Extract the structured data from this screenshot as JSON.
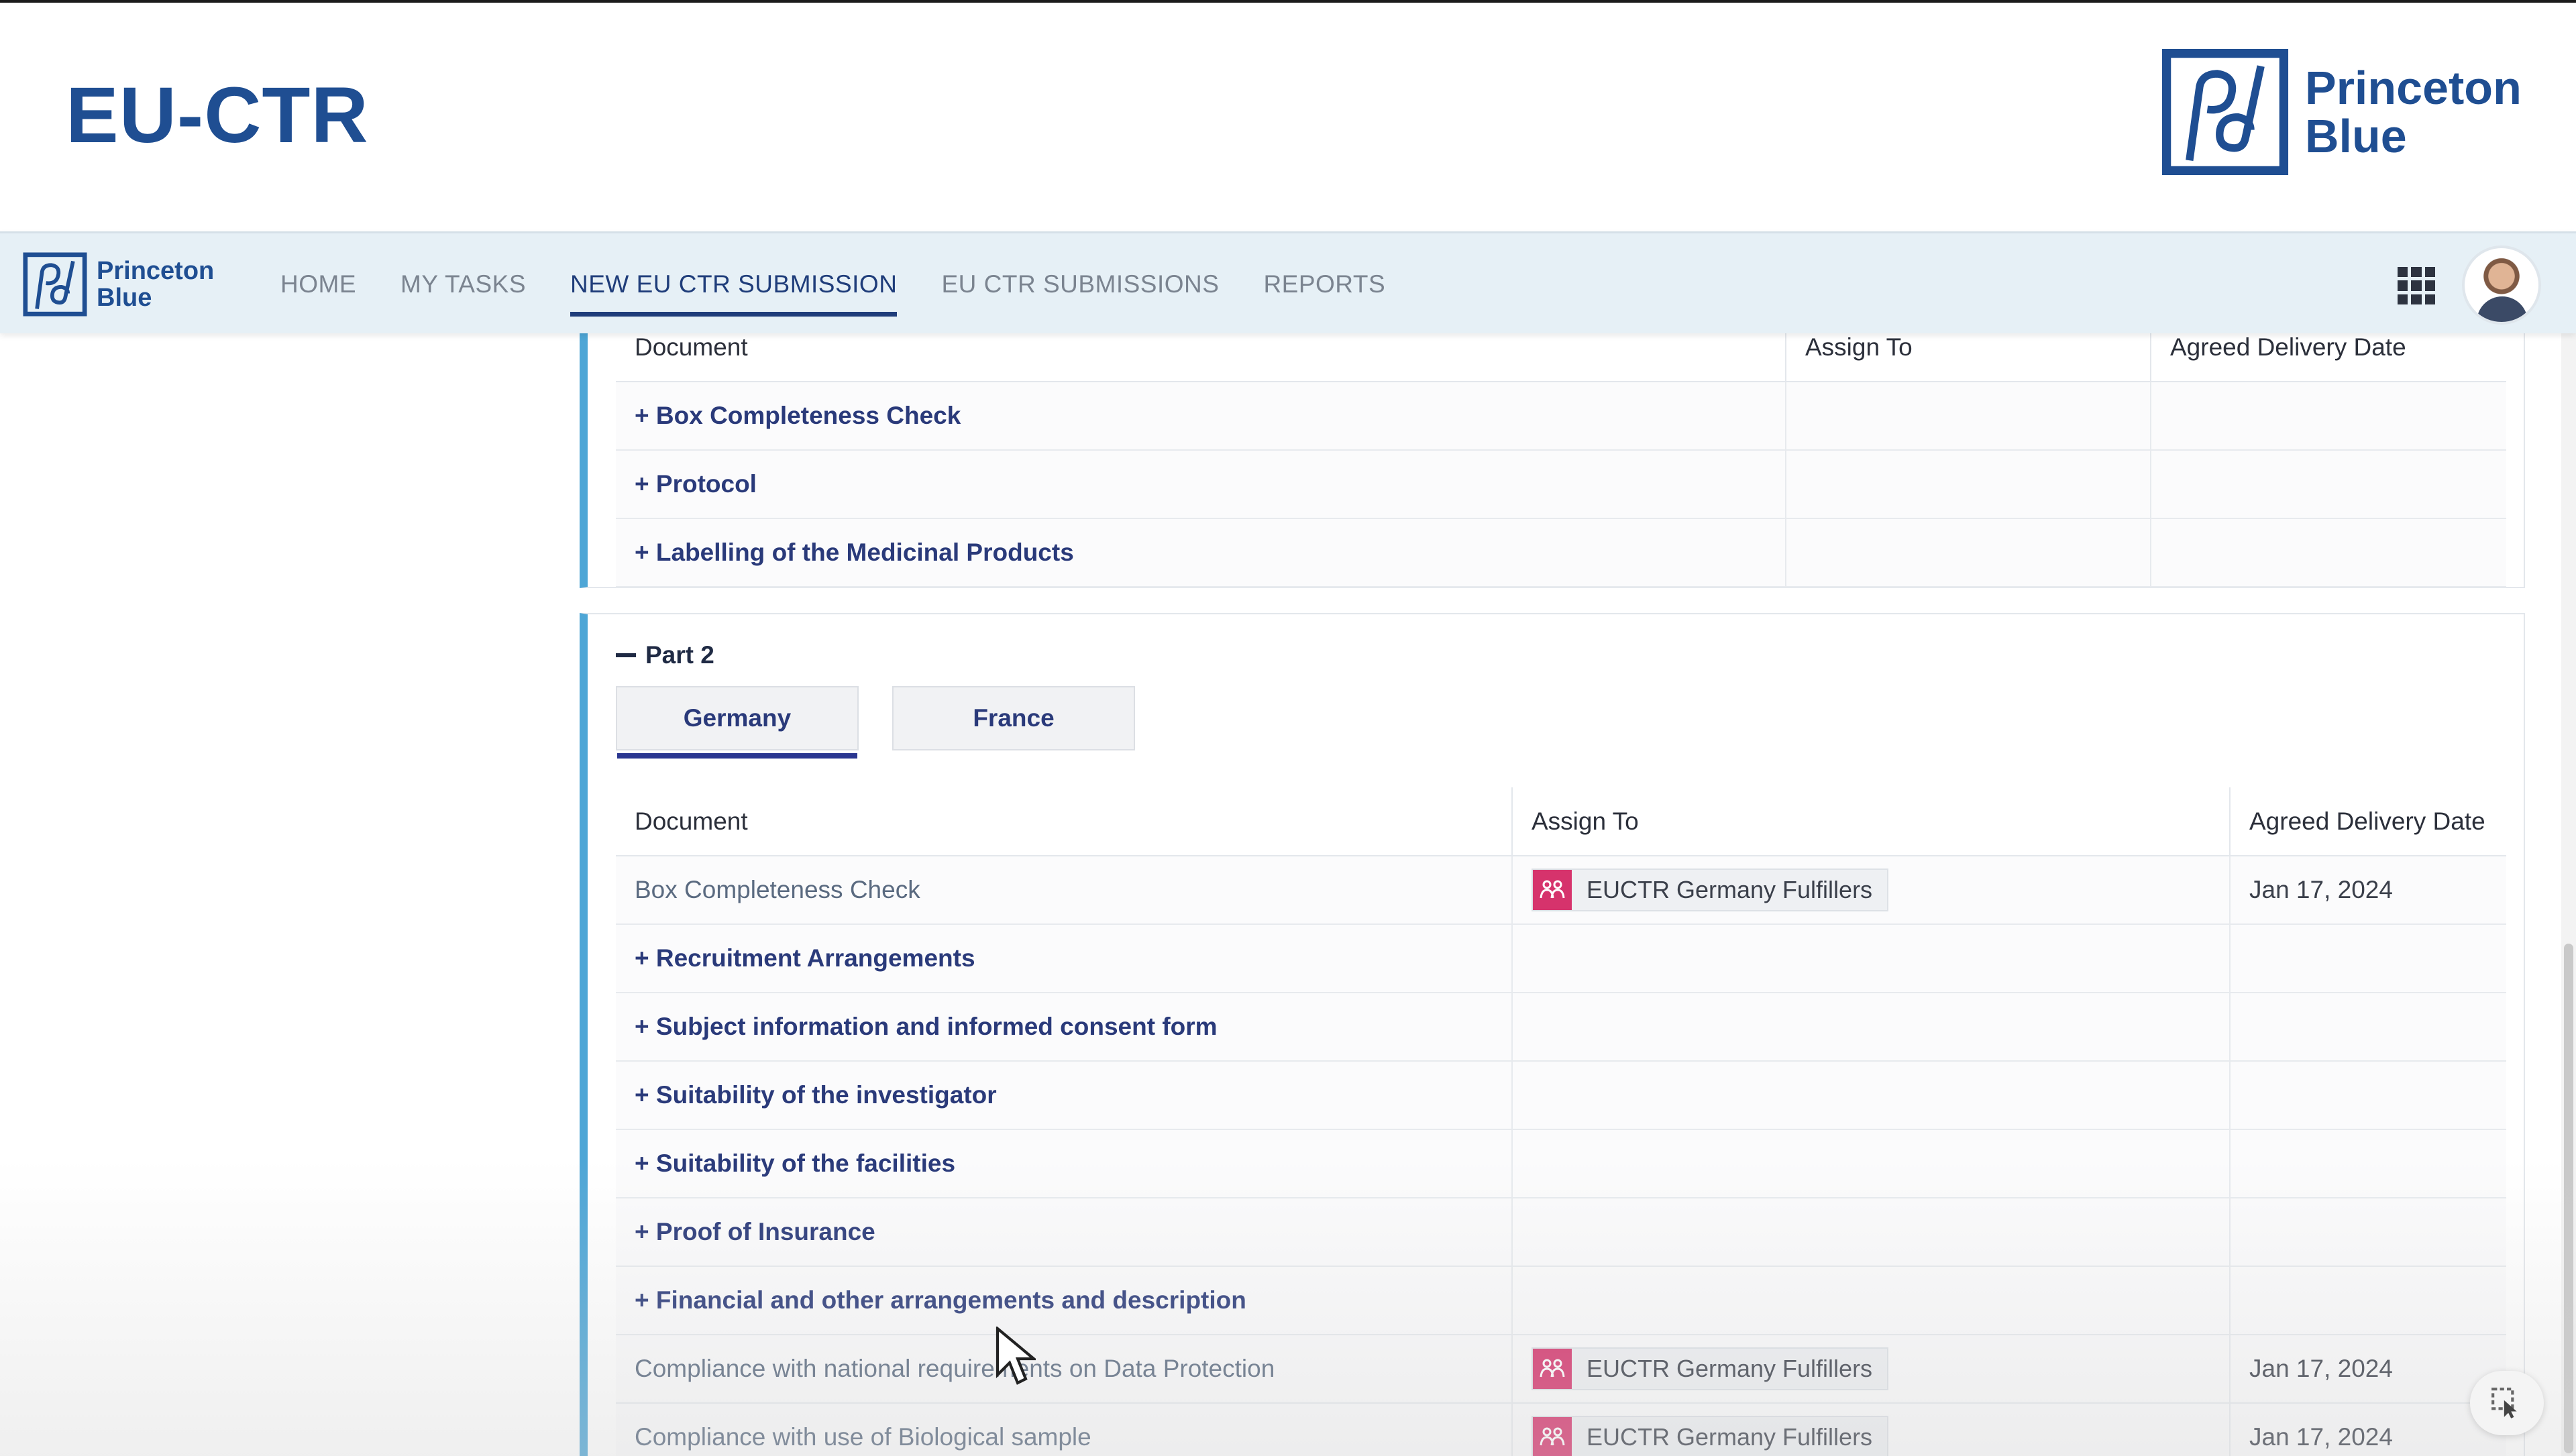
{
  "app": {
    "title": "EU-CTR"
  },
  "brand": {
    "line1": "Princeton",
    "line2": "Blue",
    "color": "#1f4e92"
  },
  "nav": {
    "items": [
      {
        "label": "HOME",
        "active": false
      },
      {
        "label": "MY TASKS",
        "active": false
      },
      {
        "label": "NEW EU CTR SUBMISSION",
        "active": true
      },
      {
        "label": "EU CTR SUBMISSIONS",
        "active": false
      },
      {
        "label": "REPORTS",
        "active": false
      }
    ],
    "apps_icon": "grid-icon",
    "avatar": "user-avatar"
  },
  "part1": {
    "columns": [
      "Document",
      "Assign To",
      "Agreed Delivery Date"
    ],
    "rows": [
      {
        "document": "+ Box Completeness Check",
        "assign_to": "",
        "date": ""
      },
      {
        "document": "+ Protocol",
        "assign_to": "",
        "date": ""
      },
      {
        "document": "+ Labelling of the Medicinal Products",
        "assign_to": "",
        "date": ""
      }
    ]
  },
  "part2": {
    "title": "Part 2",
    "tabs": [
      {
        "label": "Germany",
        "active": true
      },
      {
        "label": "France",
        "active": false
      }
    ],
    "columns": [
      "Document",
      "Assign To",
      "Agreed Delivery Date"
    ],
    "rows": [
      {
        "document": "Box Completeness Check",
        "group": false,
        "assign_to": "EUCTR Germany Fulfillers",
        "date": "Jan 17, 2024"
      },
      {
        "document": "+ Recruitment Arrangements",
        "group": true,
        "assign_to": "",
        "date": ""
      },
      {
        "document": "+ Subject information and informed consent form",
        "group": true,
        "assign_to": "",
        "date": ""
      },
      {
        "document": "+ Suitability of the investigator",
        "group": true,
        "assign_to": "",
        "date": ""
      },
      {
        "document": "+ Suitability of the facilities",
        "group": true,
        "assign_to": "",
        "date": ""
      },
      {
        "document": "+ Proof of Insurance",
        "group": true,
        "assign_to": "",
        "date": ""
      },
      {
        "document": "+ Financial and other arrangements and description",
        "group": true,
        "assign_to": "",
        "date": ""
      },
      {
        "document": "Compliance with national requirements on Data Protection",
        "group": false,
        "assign_to": "EUCTR Germany Fulfillers",
        "date": "Jan 17, 2024"
      },
      {
        "document": "Compliance with use of Biological sample",
        "group": false,
        "assign_to": "EUCTR Germany Fulfillers",
        "date": "Jan 17, 2024"
      }
    ]
  },
  "colors": {
    "accent_bar": "#4ea6d6",
    "nav_bg": "#e6f0f6",
    "group_badge": "#d6336c",
    "active_tab": "#2a3690"
  }
}
